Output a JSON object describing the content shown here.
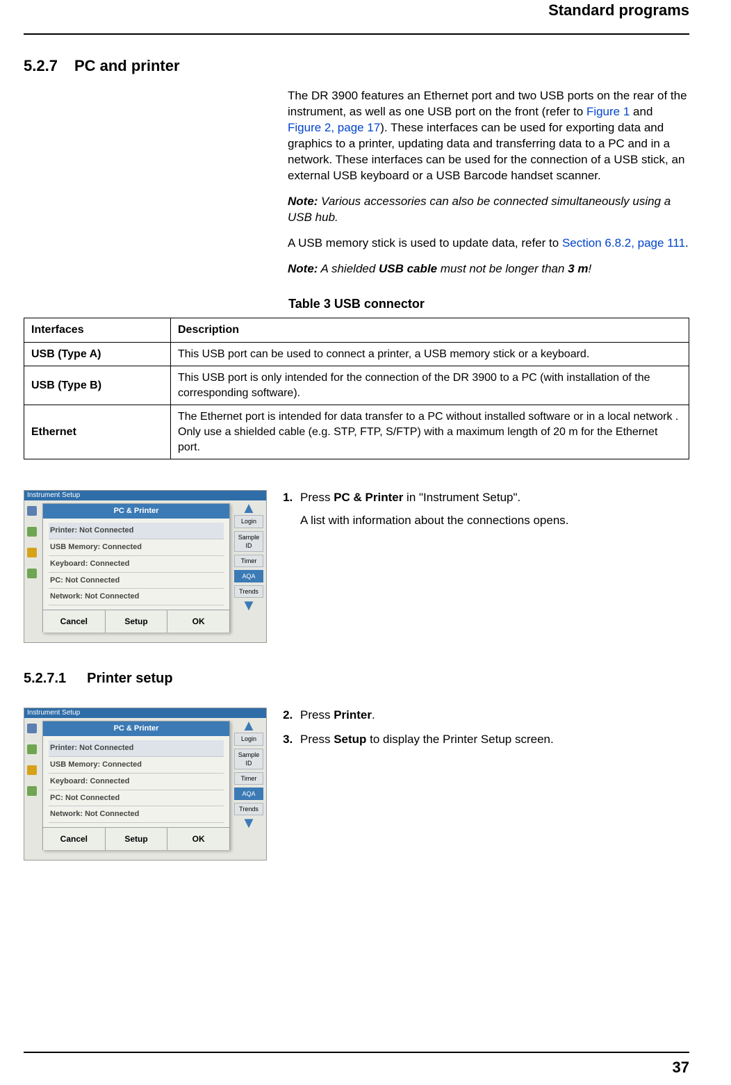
{
  "runningHead": "Standard programs",
  "section": {
    "num": "5.2.7",
    "title": "PC and printer"
  },
  "para1_a": "The DR 3900 features an Ethernet port and two USB ports on the rear of the instrument, as well as one USB port on the front (refer to ",
  "link1": "Figure 1",
  "para1_b": " and ",
  "link2": "Figure 2, page 17",
  "para1_c": "). These interfaces can be used for exporting data and graphics to a printer, updating data and transferring data to a PC and in a network. These interfaces can be used for the connection of a USB stick, an external USB keyboard or a USB Barcode handset scanner.",
  "note1_label": "Note:",
  "note1_body": " Various accessories can also be connected simultaneously using a USB hub.",
  "para2_a": "A USB memory stick is used to update data, refer to ",
  "link3": "Section 6.8.2, page 111",
  "para2_b": ".",
  "note2_label": "Note:",
  "note2_a": " A shielded ",
  "note2_bold1": "USB cable",
  "note2_b": " must not be longer than  ",
  "note2_bold2": "3 m",
  "note2_c": "!",
  "tableCaption": "Table 3 USB connector",
  "tbl": {
    "h1": "Interfaces",
    "h2": "Description",
    "r1c1": "USB (Type A)",
    "r1c2": "This USB port can be used to connect a printer, a USB memory stick or a keyboard.",
    "r2c1": "USB (Type B)",
    "r2c2": "This USB port is only intended for the connection of the DR 3900 to a PC (with installation of the corresponding software).",
    "r3c1": "Ethernet",
    "r3c2": "The Ethernet port is intended for data transfer to a PC without installed software or in a local network  . Only use a shielded cable (e.g. STP, FTP, S/FTP) with a maximum length of 20 m for the Ethernet port."
  },
  "shot": {
    "windowTitle": "Instrument Setup",
    "cardTitle": "PC & Printer",
    "rows": {
      "r0": "Printer: Not Connected",
      "r1": "USB Memory: Connected",
      "r2": "Keyboard: Connected",
      "r3": "PC: Not Connected",
      "r4": "Network: Not Connected"
    },
    "btnCancel": "Cancel",
    "btnSetup": "Setup",
    "btnOK": "OK",
    "right": {
      "login": "Login",
      "sampleID": "Sample ID",
      "timer": "Timer",
      "aqa": "AQA",
      "trends": "Trends"
    }
  },
  "step1_a": "Press ",
  "step1_bold": "PC & Printer",
  "step1_b": " in \"Instrument Setup\".",
  "step1_sub": "A list with information about the connections opens.",
  "subsection": {
    "num": "5.2.7.1",
    "title": "Printer setup"
  },
  "step2_a": "Press ",
  "step2_bold": "Printer",
  "step2_b": ".",
  "step3_a": "Press ",
  "step3_bold": "Setup",
  "step3_b": " to display the Printer Setup screen.",
  "pageNumber": "37"
}
